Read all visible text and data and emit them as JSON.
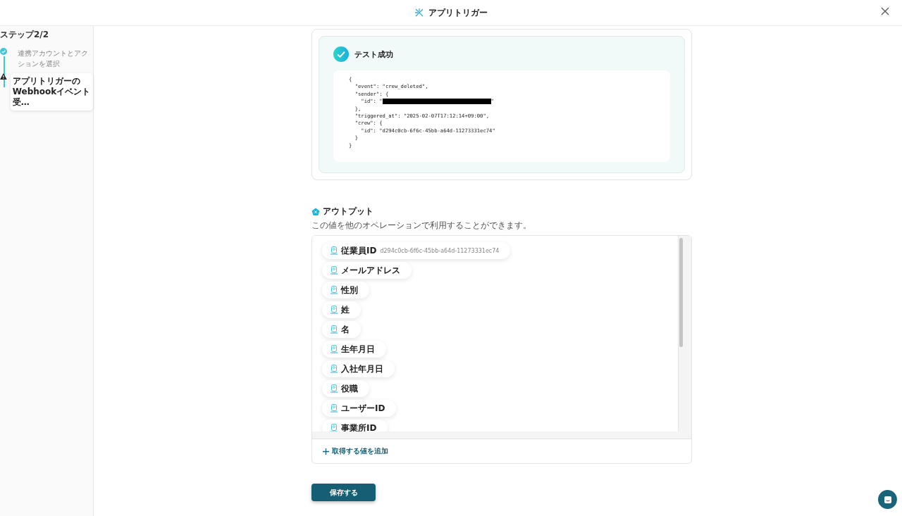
{
  "header": {
    "title": "アプリトリガー"
  },
  "sidebar": {
    "step_label": "ステップ2/2",
    "steps": [
      {
        "label": "連携アカウントとアクションを選択",
        "completed": true,
        "selected": false
      },
      {
        "label": "アプリトリガーのWebhookイベント受…",
        "completed": false,
        "selected": true
      }
    ]
  },
  "test_result": {
    "title": "テスト成功",
    "code_lines": [
      {
        "kind": "plain",
        "text": "{"
      },
      {
        "kind": "plain",
        "text": "  \"event\": \"crew_deleted\","
      },
      {
        "kind": "plain",
        "text": "  \"sender\": {"
      },
      {
        "kind": "redacted",
        "text": "    \"id\": \"",
        "after": "\""
      },
      {
        "kind": "plain",
        "text": "  },"
      },
      {
        "kind": "plain",
        "text": "  \"triggered_at\": \"2025-02-07T17:12:14+09:00\","
      },
      {
        "kind": "plain",
        "text": "  \"crew\": {"
      },
      {
        "kind": "plain",
        "text": "    \"id\": \"d294c0cb-6f6c-45bb-a64d-11273331ec74\""
      },
      {
        "kind": "plain",
        "text": "  }"
      },
      {
        "kind": "plain",
        "text": "}"
      }
    ]
  },
  "output": {
    "title": "アウトプット",
    "description": "この値を他のオペレーションで利用することができます。",
    "items": [
      {
        "label": "従業員ID",
        "value": "d294c0cb-6f6c-45bb-a64d-11273331ec74"
      },
      {
        "label": "メールアドレス"
      },
      {
        "label": "性別"
      },
      {
        "label": "姓"
      },
      {
        "label": "名"
      },
      {
        "label": "生年月日"
      },
      {
        "label": "入社年月日"
      },
      {
        "label": "役職"
      },
      {
        "label": "ユーザーID"
      },
      {
        "label": "事業所ID"
      }
    ],
    "add_label": "取得する値を追加"
  },
  "save_button": "保存する"
}
